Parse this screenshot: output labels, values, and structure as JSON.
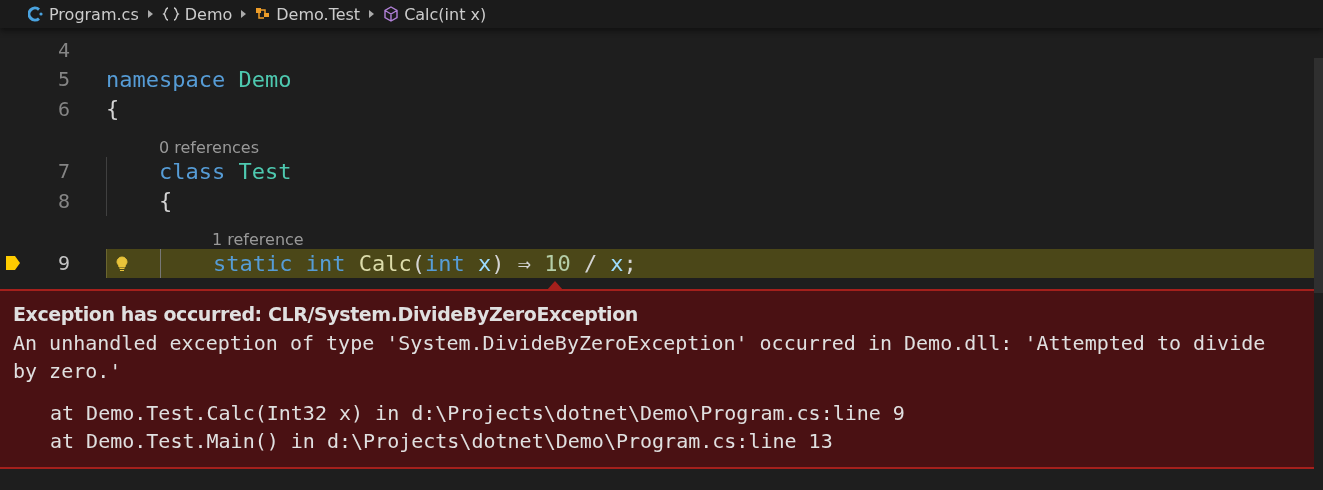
{
  "breadcrumbs": [
    {
      "kind": "file",
      "label": "Program.cs"
    },
    {
      "kind": "namespace",
      "label": "Demo"
    },
    {
      "kind": "class",
      "label": "Demo.Test"
    },
    {
      "kind": "method",
      "label": "Calc(int x)"
    }
  ],
  "lines": [
    {
      "number": "4"
    },
    {
      "number": "5",
      "tokens": [
        {
          "kind": "keyword",
          "text": "namespace"
        },
        {
          "kind": "type",
          "text": "Demo",
          "space": true
        }
      ]
    },
    {
      "number": "6",
      "tokens": [
        {
          "kind": "punct",
          "text": "{"
        }
      ],
      "children": [
        {
          "number": "7",
          "lens": "0 references",
          "tokens": [
            {
              "kind": "keyword",
              "text": "class"
            },
            {
              "kind": "type",
              "text": "Test",
              "space": true
            }
          ]
        },
        {
          "number": "8",
          "tokens": [
            {
              "kind": "punct",
              "text": "{"
            }
          ],
          "children": [
            {
              "number": "9",
              "lens": "1 reference",
              "current": true,
              "tokens": [
                {
                  "kind": "keyword",
                  "text": "static"
                },
                {
                  "kind": "keyword",
                  "text": "int",
                  "space": true
                },
                {
                  "kind": "method",
                  "text": "Calc",
                  "space": true
                },
                {
                  "kind": "punct",
                  "text": "("
                },
                {
                  "kind": "keyword",
                  "text": "int"
                },
                {
                  "kind": "param",
                  "text": "x",
                  "space": true
                },
                {
                  "kind": "punct",
                  "text": ")"
                },
                {
                  "kind": "plain",
                  "text": "⇒",
                  "space": true
                },
                {
                  "kind": "number",
                  "text": "10",
                  "space": true
                },
                {
                  "kind": "plain",
                  "text": "/",
                  "space": true
                },
                {
                  "kind": "param",
                  "text": "x",
                  "space": true
                },
                {
                  "kind": "plain",
                  "text": ";"
                }
              ]
            }
          ]
        }
      ]
    }
  ],
  "exception": {
    "title": "Exception has occurred: CLR/System.DivideByZeroException",
    "message": "An unhandled exception of type 'System.DivideByZeroException' occurred in Demo.dll: 'Attempted to divide by zero.'",
    "stack": [
      "at Demo.Test.Calc(Int32 x) in d:\\Projects\\dotnet\\Demo\\Program.cs:line 9",
      "at Demo.Test.Main() in d:\\Projects\\dotnet\\Demo\\Program.cs:line 13"
    ]
  }
}
